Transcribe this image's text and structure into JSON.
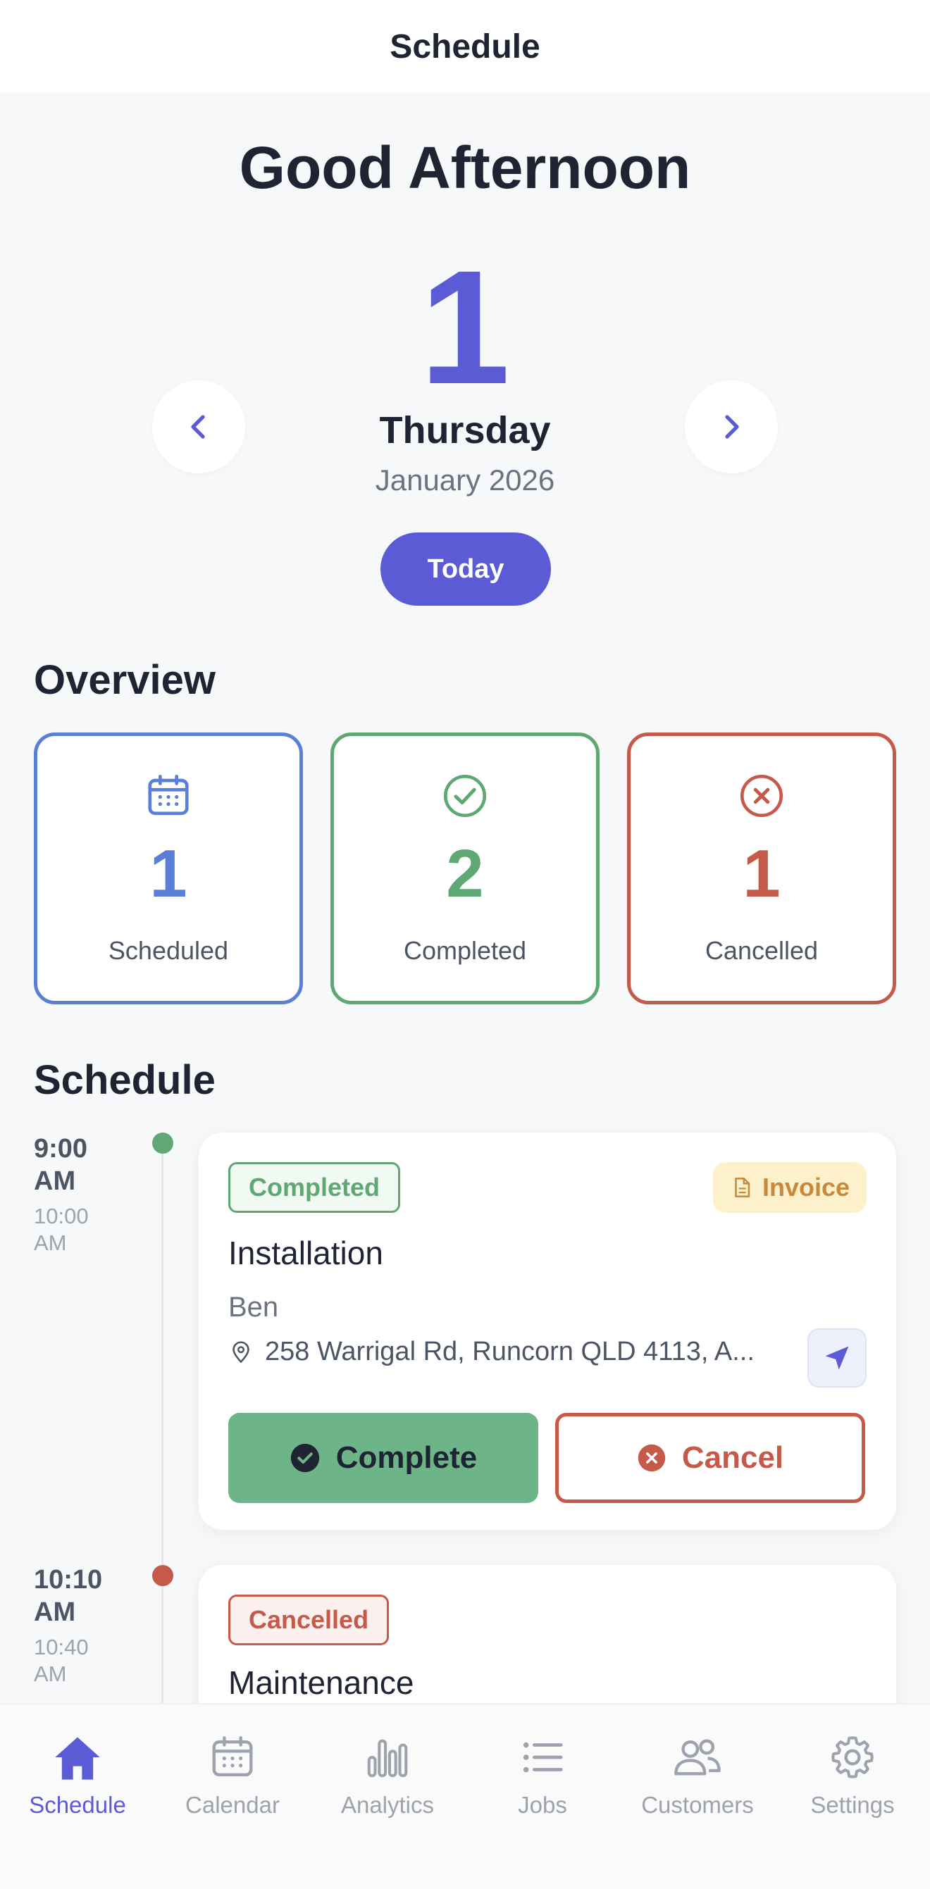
{
  "header": {
    "title": "Schedule"
  },
  "hero": {
    "greeting": "Good Afternoon",
    "day": "1",
    "weekday": "Thursday",
    "month_year": "January 2026",
    "today_label": "Today"
  },
  "overview": {
    "title": "Overview",
    "cards": [
      {
        "count": "1",
        "label": "Scheduled",
        "icon": "calendar-icon",
        "color": "#5a7fd8"
      },
      {
        "count": "2",
        "label": "Completed",
        "icon": "check-circle-icon",
        "color": "#5fa874"
      },
      {
        "count": "1",
        "label": "Cancelled",
        "icon": "x-circle-icon",
        "color": "#c65a4a"
      }
    ]
  },
  "schedule": {
    "title": "Schedule",
    "jobs": [
      {
        "start": "9:00 AM",
        "end": "10:00 AM",
        "status": "Completed",
        "status_color": "#5fa874",
        "invoice_label": "Invoice",
        "type": "Installation",
        "customer": "Ben",
        "address": "258 Warrigal Rd, Runcorn QLD 4113, A...",
        "complete_label": "Complete",
        "cancel_label": "Cancel"
      },
      {
        "start": "10:10 AM",
        "end": "10:40 AM",
        "status": "Cancelled",
        "status_color": "#c65a4a",
        "type": "Maintenance"
      }
    ]
  },
  "bottom_nav": {
    "items": [
      {
        "label": "Schedule",
        "icon": "home-icon",
        "active": true
      },
      {
        "label": "Calendar",
        "icon": "calendar-icon"
      },
      {
        "label": "Analytics",
        "icon": "bar-chart-icon"
      },
      {
        "label": "Jobs",
        "icon": "list-icon"
      },
      {
        "label": "Customers",
        "icon": "users-icon"
      },
      {
        "label": "Settings",
        "icon": "gear-icon"
      }
    ],
    "active_color": "#5b5bd6",
    "inactive_color": "#9ca3af"
  }
}
